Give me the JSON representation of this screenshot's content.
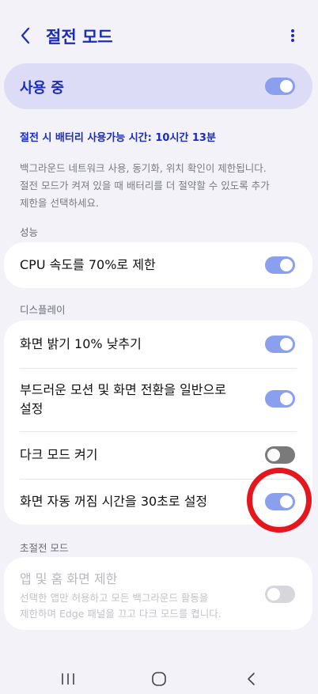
{
  "header": {
    "title": "절전 모드"
  },
  "master": {
    "label": "사용 중",
    "enabled": true
  },
  "info": {
    "battery_time": "절전 시 배터리 사용가능 시간: 10시간 13분",
    "description_line1": "백그라운드 네트워크 사용, 동기화, 위치 확인이 제한됩니다.",
    "description_line2": "절전 모드가 켜져 있을 때 배터리를 더 절약할 수 있도록 추가",
    "description_line3": "제한을 선택하세요."
  },
  "sections": {
    "performance": {
      "header": "성능",
      "cpu_label": "CPU 속도를 70%로 제한",
      "cpu_enabled": true
    },
    "display": {
      "header": "디스플레이",
      "brightness_label": "화면 밝기 10% 낮추기",
      "brightness_enabled": true,
      "motion_label_line1": "부드러운 모션 및 화면 전환을 일반으로",
      "motion_label_line2": "설정",
      "motion_enabled": true,
      "dark_label": "다크 모드 켜기",
      "dark_enabled": false,
      "timeout_label": "화면 자동 꺼짐 시간을 30초로 설정",
      "timeout_enabled": true
    },
    "ultra": {
      "header": "초절전 모드",
      "title": "앱 및 홈 화면 제한",
      "desc_line1": "선택한 앱만 허용하고 모든 백그라운드 활동을",
      "desc_line2": "제한하며 Edge 패널을 끄고 다크 모드를 켭니다.",
      "enabled": false,
      "disabled": true
    }
  },
  "icons": {
    "back": "chevron-left-icon",
    "more": "more-vertical-icon",
    "nav_recents": "recents-icon",
    "nav_home": "home-icon",
    "nav_back": "back-icon"
  },
  "colors": {
    "accent": "#1a2bbf",
    "toggle_on": "#8aa0ee",
    "toggle_off": "#7a7a7a",
    "highlight": "#e5171e",
    "background": "#f2f2f8"
  }
}
